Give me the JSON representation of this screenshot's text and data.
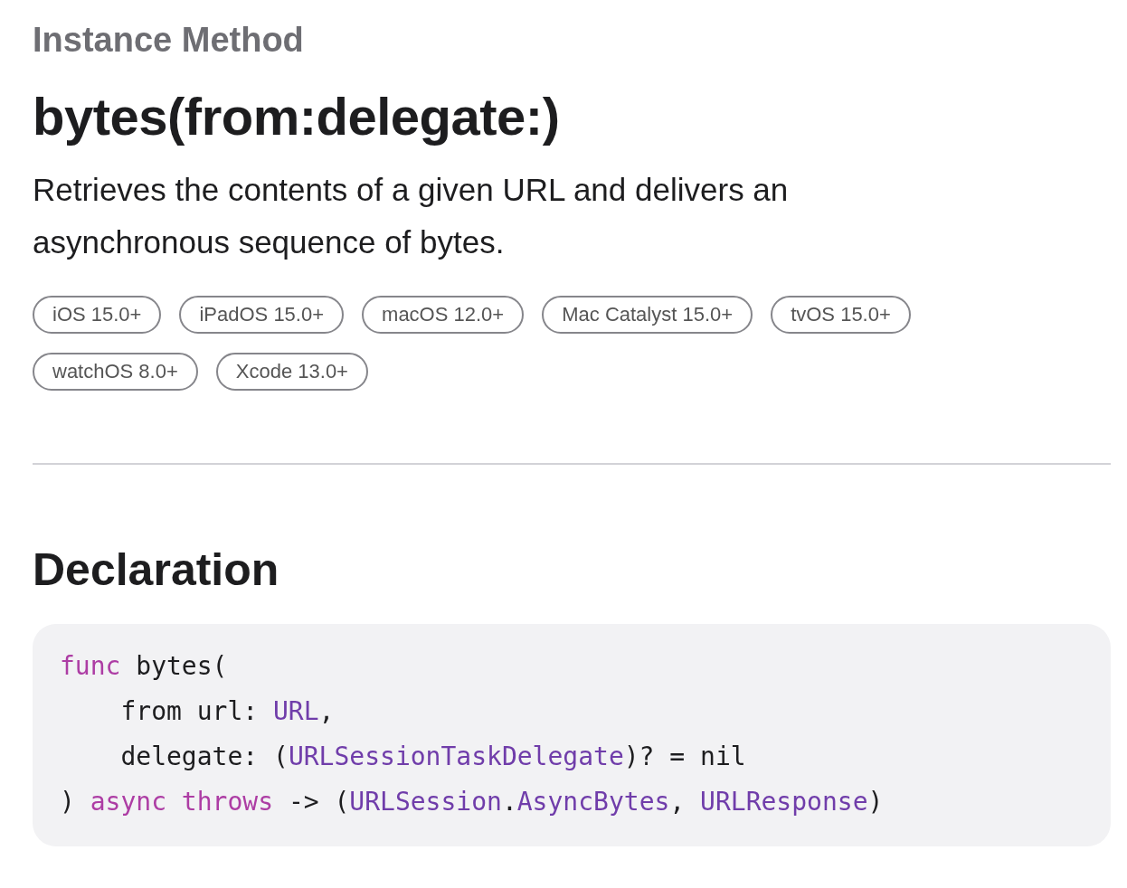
{
  "eyebrow": "Instance Method",
  "title": "bytes(from:delegate:)",
  "abstract": "Retrieves the contents of a given URL and delivers an asynchronous sequence of bytes.",
  "availability": [
    "iOS 15.0+",
    "iPadOS 15.0+",
    "macOS 12.0+",
    "Mac Catalyst 15.0+",
    "tvOS 15.0+",
    "watchOS 8.0+",
    "Xcode 13.0+"
  ],
  "declaration": {
    "heading": "Declaration",
    "lines": [
      [
        {
          "kind": "keyword",
          "text": "func"
        },
        {
          "kind": "plain",
          "text": " bytes("
        }
      ],
      [
        {
          "kind": "plain",
          "text": "    from url: "
        },
        {
          "kind": "type",
          "text": "URL"
        },
        {
          "kind": "plain",
          "text": ","
        }
      ],
      [
        {
          "kind": "plain",
          "text": "    delegate: ("
        },
        {
          "kind": "type",
          "text": "URLSessionTaskDelegate"
        },
        {
          "kind": "plain",
          "text": ")? = nil"
        }
      ],
      [
        {
          "kind": "plain",
          "text": ") "
        },
        {
          "kind": "keyword",
          "text": "async"
        },
        {
          "kind": "keyword",
          "text": " throws"
        },
        {
          "kind": "plain",
          "text": " -> ("
        },
        {
          "kind": "type",
          "text": "URLSession"
        },
        {
          "kind": "plain",
          "text": "."
        },
        {
          "kind": "type",
          "text": "AsyncBytes"
        },
        {
          "kind": "plain",
          "text": ", "
        },
        {
          "kind": "type",
          "text": "URLResponse"
        },
        {
          "kind": "plain",
          "text": ")"
        }
      ]
    ]
  }
}
